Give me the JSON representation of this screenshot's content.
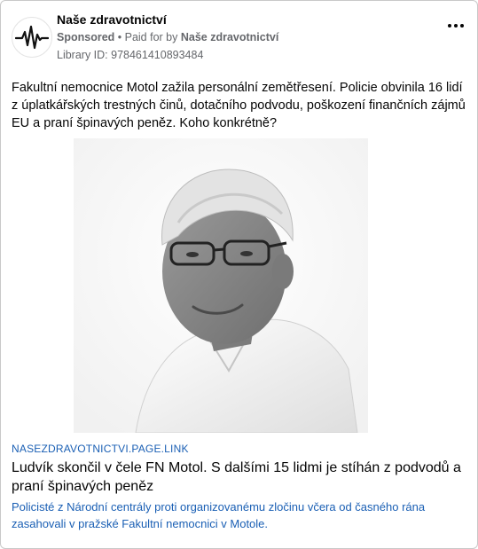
{
  "post": {
    "page_name": "Naše zdravotnictví",
    "sponsored_label": "Sponsored",
    "paid_for_prefix": " • Paid for by ",
    "payer": "Naše zdravotnictví",
    "library_id": "Library ID: 978461410893484",
    "more_icon": "more-options-icon",
    "avatar_icon": "heartbeat-logo-icon",
    "text": "Fakultní nemocnice Motol zažila personální zemětřesení. Policie obvinila 16 lidí z úplatkářských trestných činů, dotačního podvodu, poškození finančních zájmů EU a praní špinavých peněz. Koho konkrétně?"
  },
  "link_preview": {
    "domain": "NASEZDRAVOTNICTVI.PAGE.LINK",
    "headline": "Ludvík skončil v čele FN Motol. S dalšími 15 lidmi je stíhán z podvodů a praní špinavých peněz",
    "description": "Policisté z Národní centrály proti organizovanému zločinu včera od časného rána zasahovali v pražské Fakultní nemocnici v Motole."
  },
  "colors": {
    "link_blue": "#1a5fb4",
    "meta_gray": "#65676b",
    "text": "#050505"
  }
}
